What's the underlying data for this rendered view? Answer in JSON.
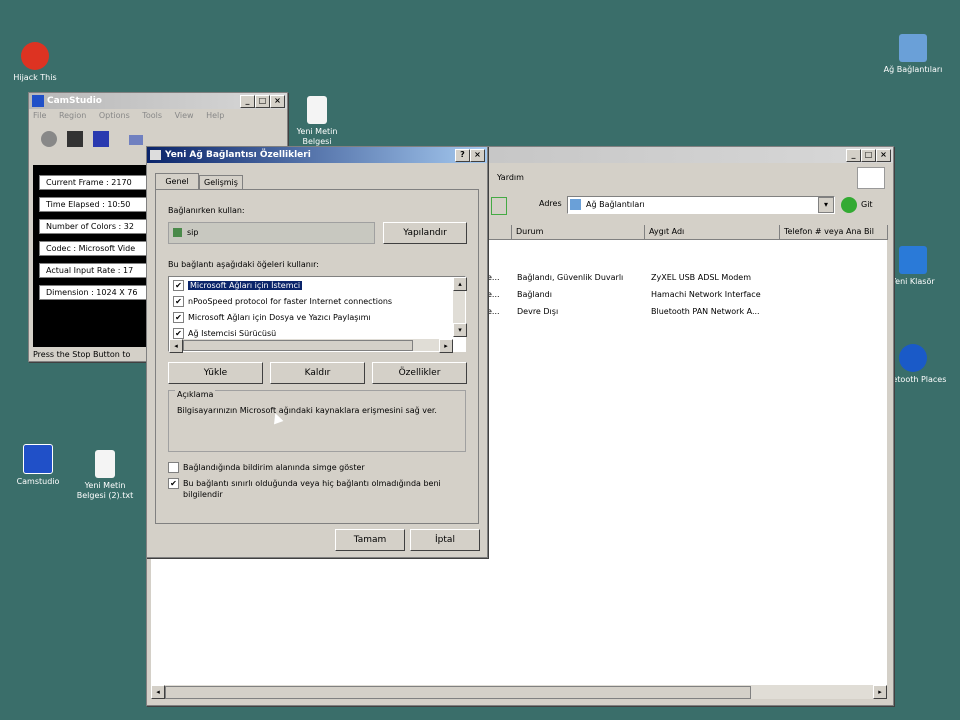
{
  "desktop": {
    "icons": [
      {
        "label": "Hijack This"
      },
      {
        "label": "Yeni Metin Belgesi"
      },
      {
        "label": "Ağ Bağlantıları"
      },
      {
        "label": "Yeni Klasör"
      },
      {
        "label": "Camstudio"
      },
      {
        "label": "Yeni Metin Belgesi (2).txt"
      },
      {
        "label": "Bluetooth Places"
      }
    ]
  },
  "player": {
    "title": "CamStudio",
    "menu": [
      "File",
      "Region",
      "Options",
      "Tools",
      "View",
      "Help"
    ],
    "stats": [
      "Current Frame : 2170",
      "Time Elapsed : 10:50",
      "Number of Colors : 32",
      "Codec : Microsoft Vide",
      "Actual Input Rate : 17",
      "Dimension : 1024 X 76"
    ],
    "status": "Press the Stop Button to"
  },
  "netwin": {
    "menu_tail": "Yardım",
    "address_label": "Adres",
    "address_value": "Ağ Bağlantıları",
    "go_label": "Git",
    "columns": [
      "Durum",
      "Aygıt Adı",
      "Telefon # veya Ana Bil"
    ],
    "rows": [
      {
        "prefix": "e...",
        "status": "Bağlandı, Güvenlik Duvarlı",
        "device": "ZyXEL USB ADSL Modem"
      },
      {
        "prefix": "e...",
        "status": "Bağlandı",
        "device": "Hamachi Network Interface"
      },
      {
        "prefix": "e...",
        "status": "Devre Dışı",
        "device": "Bluetooth PAN Network A..."
      }
    ]
  },
  "dialog": {
    "title": "Yeni Ağ Bağlantısı Özellikleri",
    "tabs": [
      "Genel",
      "Gelişmiş"
    ],
    "connect_using_label": "Bağlanırken kullan:",
    "device_value": "sip",
    "configure_button": "Yapılandır",
    "components_label": "Bu bağlantı aşağıdaki öğeleri kullanır:",
    "components": [
      {
        "label": "Microsoft Ağları için İstemci",
        "checked": true,
        "selected": true
      },
      {
        "label": "nPooSpeed protocol for faster Internet connections",
        "checked": true,
        "selected": false
      },
      {
        "label": "Microsoft Ağları için Dosya ve Yazıcı Paylaşımı",
        "checked": true,
        "selected": false
      },
      {
        "label": "Ağ Istemcisi Sürücüsü",
        "checked": true,
        "selected": false
      }
    ],
    "install_button": "Yükle",
    "uninstall_button": "Kaldır",
    "properties_button": "Özellikler",
    "description_title": "Açıklama",
    "description_text": "Bilgisayarınızın Microsoft ağındaki kaynaklara erişmesini sağ ver.",
    "checkbox1_label": "Bağlandığında bildirim alanında simge göster",
    "checkbox1_checked": false,
    "checkbox2_label": "Bu bağlantı sınırlı olduğunda veya hiç bağlantı olmadığında beni bilgilendir",
    "checkbox2_checked": true,
    "ok_button": "Tamam",
    "cancel_button": "İptal"
  },
  "colors": {
    "desktop": "#3a6e6a",
    "titlebar": "#0a246a",
    "selection": "#0a246a"
  }
}
